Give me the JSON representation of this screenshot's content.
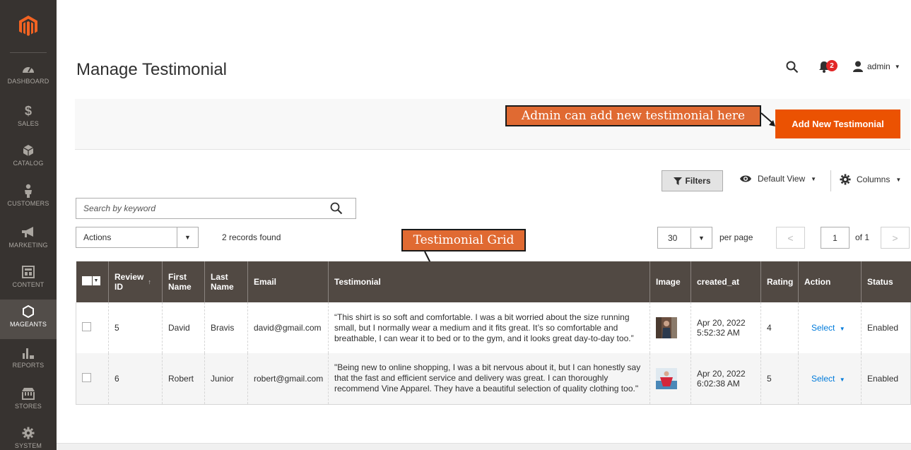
{
  "sidebar": {
    "items": [
      {
        "label": "DASHBOARD",
        "icon": "dashboard-icon"
      },
      {
        "label": "SALES",
        "icon": "dollar-icon"
      },
      {
        "label": "CATALOG",
        "icon": "cube-icon"
      },
      {
        "label": "CUSTOMERS",
        "icon": "person-icon"
      },
      {
        "label": "MARKETING",
        "icon": "megaphone-icon"
      },
      {
        "label": "CONTENT",
        "icon": "content-icon"
      },
      {
        "label": "MAGEANTS",
        "icon": "hexagon-icon"
      },
      {
        "label": "REPORTS",
        "icon": "bar-chart-icon"
      },
      {
        "label": "STORES",
        "icon": "store-icon"
      },
      {
        "label": "SYSTEM",
        "icon": "gear-icon"
      }
    ],
    "active_index": 6
  },
  "header": {
    "title": "Manage Testimonial",
    "notifications_count": "2",
    "user": "admin"
  },
  "action_bar": {
    "add_button": "Add New Testimonial"
  },
  "annotations": {
    "add_hint": "Admin can add new testimonial here",
    "grid_hint": "Testimonial Grid"
  },
  "toolbar": {
    "filters": "Filters",
    "default_view": "Default View",
    "columns": "Columns",
    "search_placeholder": "Search by keyword",
    "actions": "Actions",
    "records_found": "2 records found",
    "per_page_value": "30",
    "per_page_label": "per page",
    "page_current": "1",
    "page_of": "of 1"
  },
  "grid": {
    "headers": [
      "Review ID",
      "First Name",
      "Last Name",
      "Email",
      "Testimonial",
      "Image",
      "created_at",
      "Rating",
      "Action",
      "Status"
    ],
    "header_lines": {
      "review_id": [
        "Review",
        "ID"
      ],
      "first_name": [
        "First",
        "Name"
      ],
      "last_name": [
        "Last",
        "Name"
      ]
    },
    "rows": [
      {
        "id": "5",
        "first_name": "David",
        "last_name": "Bravis",
        "email": "david@gmail.com",
        "testimonial": "“This shirt is so soft and comfortable. I was a bit worried about the size running small, but I normally wear a medium and it fits great. It’s so comfortable and breathable, I can wear it to bed or to the gym, and it looks great day-to-day too.”",
        "created_date": "Apr 20, 2022",
        "created_time": "5:52:32 AM",
        "rating": "4",
        "action": "Select",
        "status": "Enabled"
      },
      {
        "id": "6",
        "first_name": "Robert",
        "last_name": "Junior",
        "email": "robert@gmail.com",
        "testimonial": "\"Being new to online shopping, I was a bit nervous about it, but I can honestly say that the fast and efficient service and delivery was great. I can thoroughly recommend Vine Apparel. They have a beautiful selection of quality clothing too.\"",
        "created_date": "Apr 20, 2022",
        "created_time": "6:02:38 AM",
        "rating": "5",
        "action": "Select",
        "status": "Enabled"
      }
    ]
  },
  "colors": {
    "sidebar_bg": "#373330",
    "accent": "#eb5202",
    "table_header": "#514943",
    "link": "#007bdb",
    "annotation": "#e06a32"
  }
}
